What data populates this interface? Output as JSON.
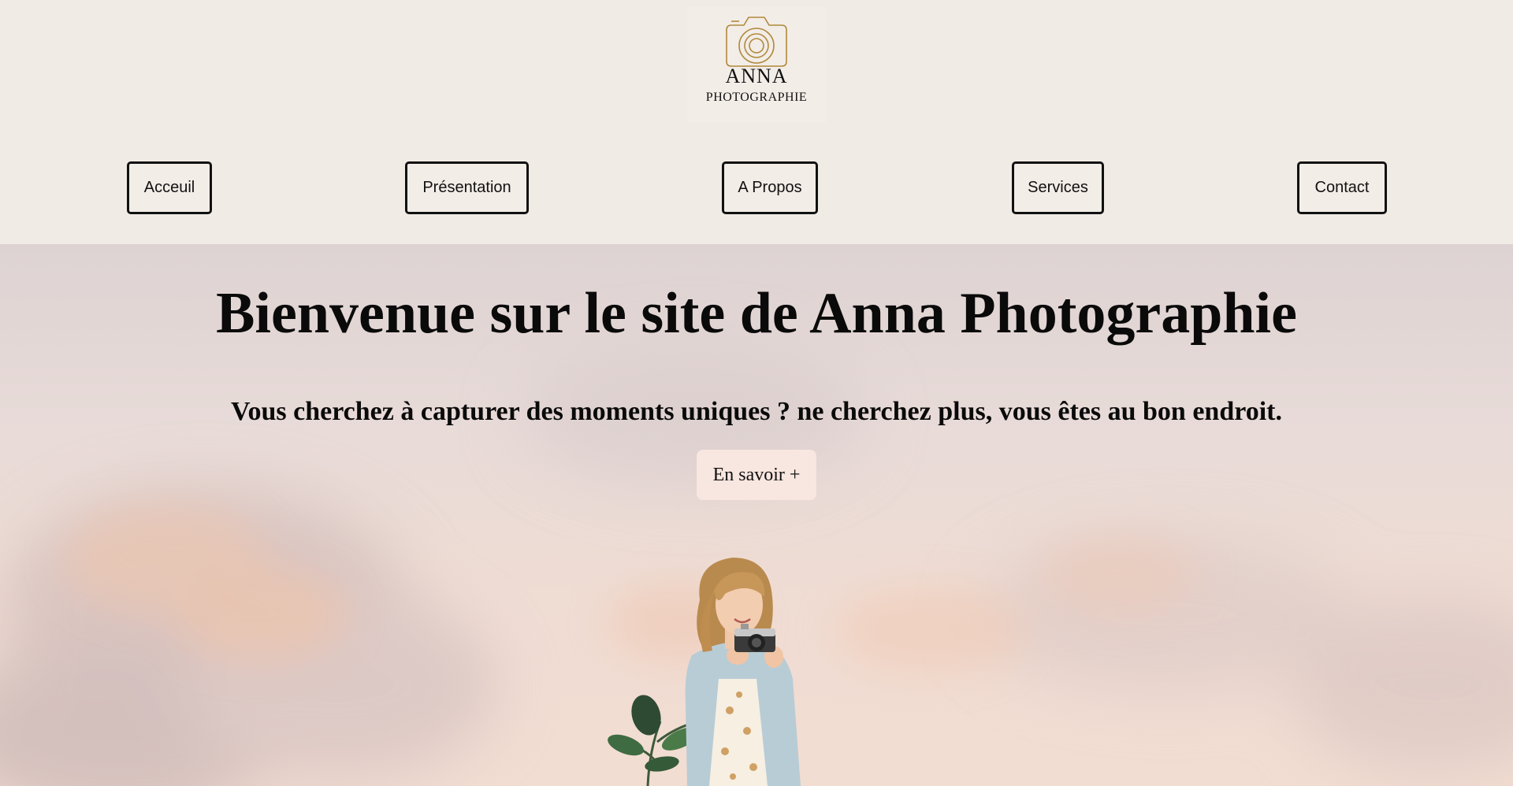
{
  "logo": {
    "name": "ANNA",
    "subtitle": "PHOTOGRAPHIE",
    "icon": "camera-icon",
    "accent_color": "#b08a3e"
  },
  "nav": {
    "items": [
      {
        "label": "Acceuil"
      },
      {
        "label": "Présentation"
      },
      {
        "label": "A Propos"
      },
      {
        "label": "Services"
      },
      {
        "label": "Contact"
      }
    ]
  },
  "hero": {
    "title": "Bienvenue sur le site de Anna Photographie",
    "subtitle": "Vous cherchez à capturer des moments uniques ? ne cherchez plus, vous êtes au bon endroit.",
    "cta_label": "En savoir +",
    "cta_color": "#f8e6e0"
  },
  "colors": {
    "page_background": "#f1ebe5",
    "button_border": "#111111"
  }
}
